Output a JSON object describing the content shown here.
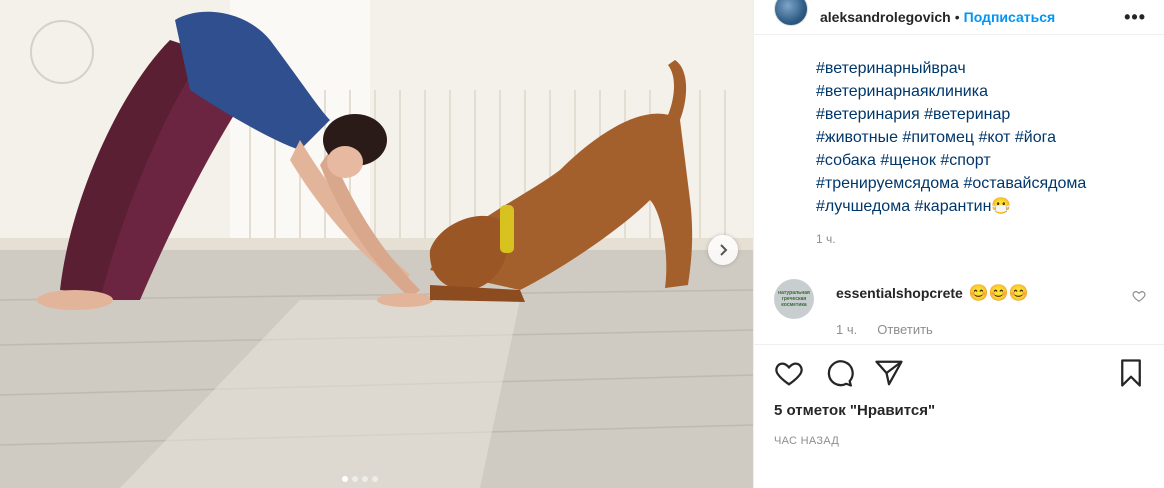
{
  "post": {
    "username": "aleksandrolegovich",
    "separator": "•",
    "follow_label": "Подписаться",
    "more_label": "•••"
  },
  "caption": {
    "lines": [
      [
        "#ветеринарныйврач"
      ],
      [
        "#ветеринарнаяклиника"
      ],
      [
        "#ветеринария",
        "#ветеринар"
      ],
      [
        "#животные",
        "#питомец",
        "#кот",
        "#йога"
      ],
      [
        "#собака",
        "#щенок",
        "#спорт"
      ],
      [
        "#тренируемсядома",
        "#оставайсядома"
      ],
      [
        "#лучшедома",
        "#карантин😷"
      ]
    ],
    "time": "1 ч."
  },
  "comment": {
    "avatar_text": "натуральная греческая косметика",
    "username": "essentialshopcrete",
    "text": "😊😊😊",
    "time": "1 ч.",
    "reply_label": "Ответить"
  },
  "likes_label": "5 отметок \"Нравится\"",
  "time_ago": "ЧАС НАЗАД",
  "carousel": {
    "dots": 4,
    "active_index": 0
  },
  "colors": {
    "link": "#0095f6",
    "hashtag": "#00376b",
    "muted": "#8e8e8e",
    "text": "#262626"
  }
}
